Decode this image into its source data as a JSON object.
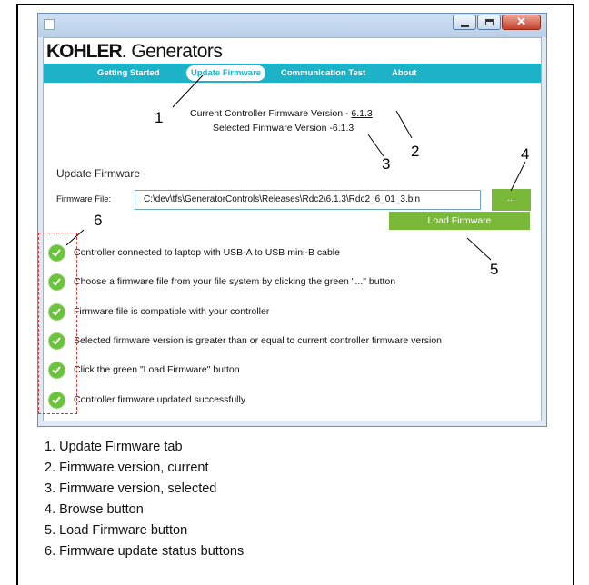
{
  "window": {
    "brand_bold": "KOHLER",
    "brand_rest": ". Generators",
    "minimize": "–",
    "maximize": "□",
    "close": "✕"
  },
  "tabs": [
    {
      "label": "Getting Started"
    },
    {
      "label": "Update Firmware",
      "active": true
    },
    {
      "label": "Communication Test"
    },
    {
      "label": "About"
    }
  ],
  "versions": {
    "current_label": "Current Controller Firmware Version - ",
    "current_value": "6.1.3",
    "selected_label": "Selected Firmware Version -",
    "selected_value": "6.1.3"
  },
  "section_title": "Update Firmware",
  "firmware_file": {
    "label": "Firmware File:",
    "value": "C:\\dev\\tfs\\GeneratorControls\\Releases\\Rdc2\\6.1.3\\Rdc2_6_01_3.bin"
  },
  "browse_label": "...",
  "load_label": "Load Firmware",
  "checklist": [
    {
      "text": "Controller connected to laptop with USB-A to USB mini-B cable",
      "status": "check"
    },
    {
      "text": "Choose a firmware file from your file system by clicking the green \"...\" button",
      "status": "check"
    },
    {
      "text": "Firmware file is compatible with your controller",
      "status": "check"
    },
    {
      "text": "Selected firmware version is greater than or equal to current controller firmware version",
      "status": "check"
    },
    {
      "text": "Click the green \"Load Firmware\" button",
      "status": "check"
    },
    {
      "text": "Controller firmware updated successfully",
      "status": "check"
    }
  ],
  "callouts": [
    "1",
    "2",
    "3",
    "4",
    "5",
    "6"
  ],
  "legend": [
    "1. Update Firmware tab",
    "2. Firmware version, current",
    "3. Firmware version, selected",
    "4. Browse button",
    "5. Load Firmware button",
    "6. Firmware update status buttons"
  ],
  "colors": {
    "tab_bar": "#1cb3c9",
    "green": "#7ab83a",
    "check": "#69c33b",
    "dash": "#e03030"
  }
}
